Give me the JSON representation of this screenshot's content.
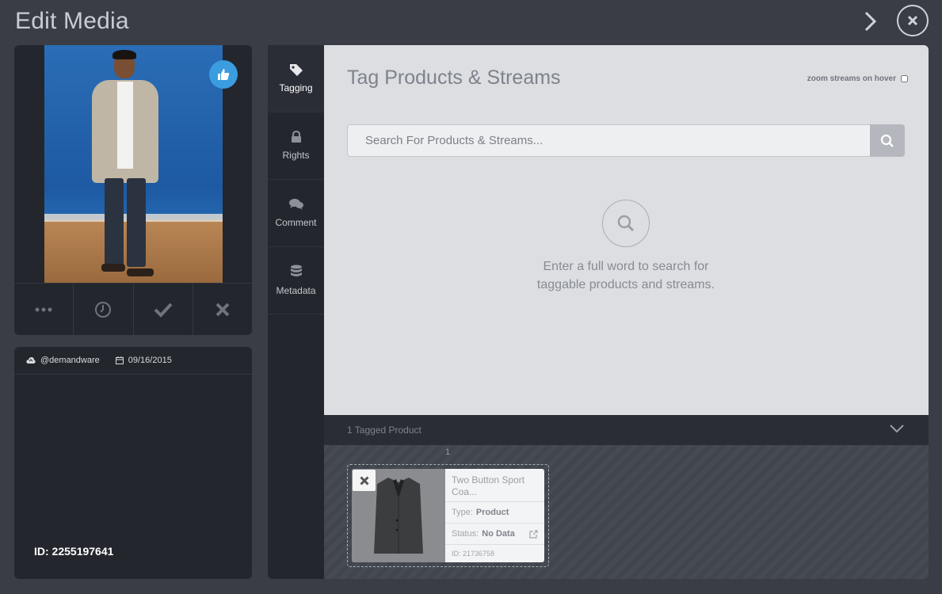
{
  "header": {
    "title": "Edit Media"
  },
  "media": {
    "actions": [
      "more-icon",
      "clock-icon",
      "check-icon",
      "close-icon"
    ]
  },
  "info": {
    "source": "@demandware",
    "date": "09/16/2015",
    "id_label": "ID: 2255197641"
  },
  "tabs": [
    {
      "label": "Tagging",
      "icon": "tag-icon",
      "active": true
    },
    {
      "label": "Rights",
      "icon": "lock-icon"
    },
    {
      "label": "Comment",
      "icon": "comment-icon"
    },
    {
      "label": "Metadata",
      "icon": "database-icon"
    }
  ],
  "tagging": {
    "title": "Tag Products & Streams",
    "zoom_label": "zoom streams on hover",
    "search_placeholder": "Search For Products & Streams...",
    "empty_line1": "Enter a full word to search for",
    "empty_line2": "taggable products and streams."
  },
  "tagged": {
    "summary": "1 Tagged Product",
    "slot_number": "1",
    "product": {
      "name_line1": "Two Button Sport",
      "name_line2": "Coa...",
      "type_label": "Type:",
      "type_value": "Product",
      "status_label": "Status:",
      "status_value": "No Data",
      "id": "ID: 21736758"
    }
  },
  "colors": {
    "accent_like": "#3b9de0",
    "background": "#3a3d46",
    "panel": "#24262d",
    "main": "#dcdee2"
  }
}
